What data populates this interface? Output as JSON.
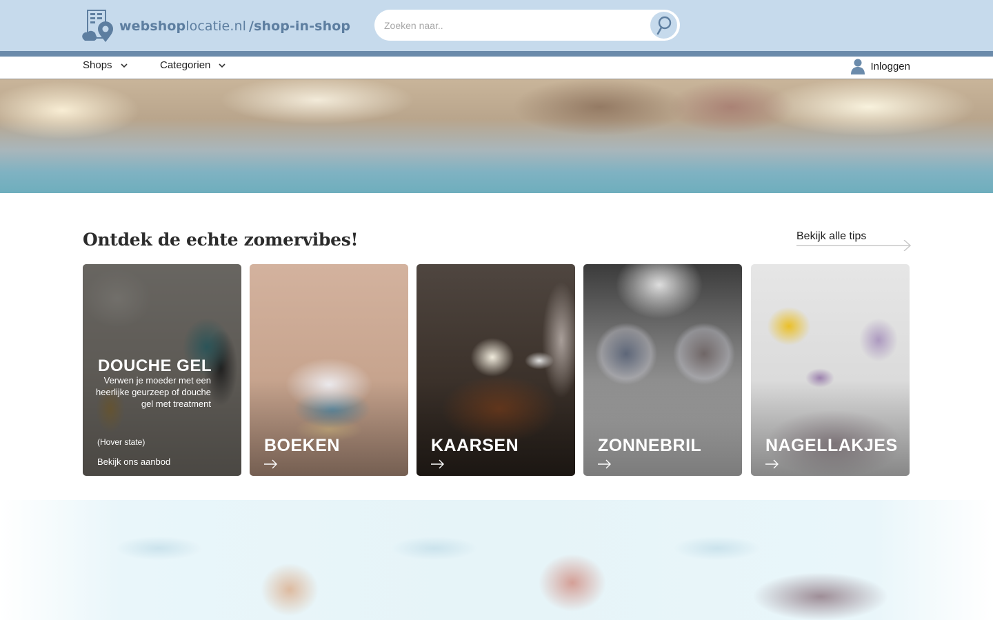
{
  "header": {
    "logo": {
      "part1_bold": "webshop",
      "part2": "locatie.nl",
      "slash": "/",
      "part3_bold": "shop-in-shop"
    },
    "search": {
      "placeholder": "Zoeken naar..",
      "icon": "search-icon"
    },
    "colors": {
      "bar": "#c6daec",
      "stripe": "#6b8bab",
      "logo": "#5d7ea0"
    }
  },
  "nav": {
    "items": [
      {
        "label": "Shops",
        "icon": "chevron-down-icon"
      },
      {
        "label": "Categorien",
        "icon": "chevron-down-icon"
      }
    ],
    "login": {
      "label": "Inloggen",
      "icon": "user-icon"
    }
  },
  "section": {
    "title": "Ontdek de echte zomervibes!",
    "see_all": "Bekijk alle tips"
  },
  "cards": [
    {
      "title": "DOUCHE GEL",
      "description": "Verwen je moeder met een heerlijke geurzeep of douche gel met treatment",
      "state_note": "(Hover state)",
      "cta": "Bekijk ons aanbod"
    },
    {
      "title": "BOEKEN",
      "icon": "arrow-right-icon"
    },
    {
      "title": "KAARSEN",
      "icon": "arrow-right-icon"
    },
    {
      "title": "ZONNEBRIL",
      "icon": "arrow-right-icon"
    },
    {
      "title": "NAGELLAKJES",
      "icon": "arrow-right-icon"
    }
  ]
}
